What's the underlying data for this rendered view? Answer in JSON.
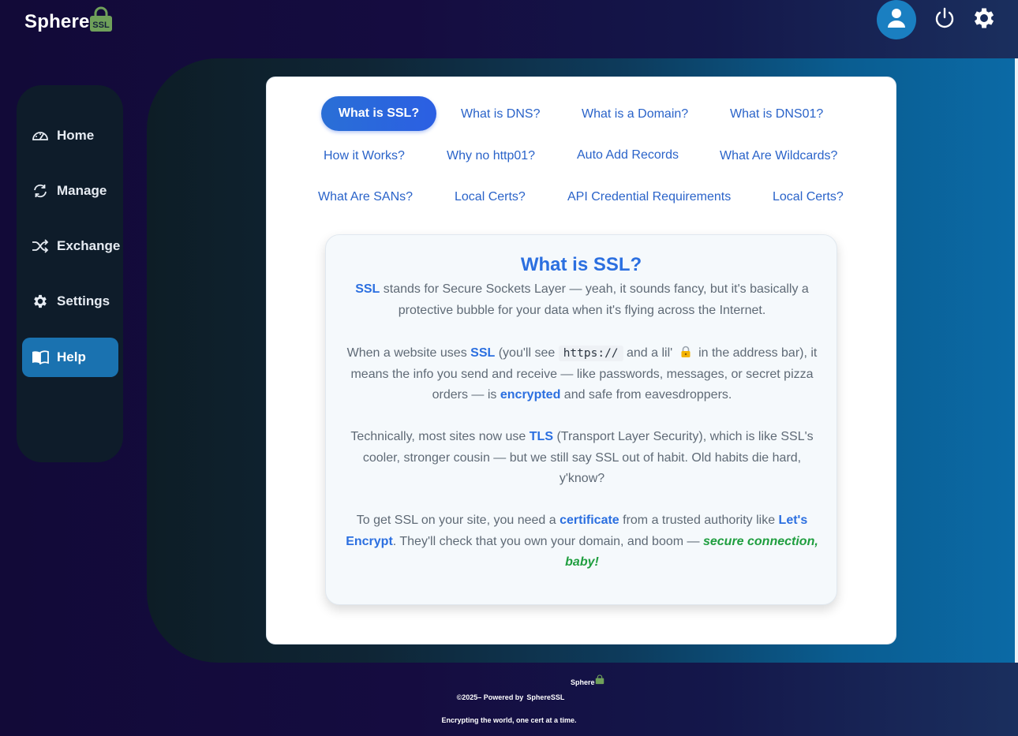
{
  "app": {
    "logo_text": "Sphere",
    "logo_badge": "SSL"
  },
  "header": {
    "icons": [
      "user-icon",
      "power-icon",
      "gear-icon"
    ]
  },
  "sidebar": {
    "items": [
      {
        "label": "Home",
        "icon": "dashboard-icon",
        "active": false
      },
      {
        "label": "Manage",
        "icon": "refresh-icon",
        "active": false
      },
      {
        "label": "Exchange",
        "icon": "shuffle-icon",
        "active": false
      },
      {
        "label": "Settings",
        "icon": "gear-icon",
        "active": false
      },
      {
        "label": "Help",
        "icon": "book-icon",
        "active": true
      }
    ]
  },
  "help": {
    "topics": [
      "What is SSL?",
      "What is DNS?",
      "What is a Domain?",
      "What is DNS01?",
      "How it Works?",
      "Why no http01?",
      "Auto Add Records",
      "What Are Wildcards?",
      "What Are SANs?",
      "Local Certs?",
      "API Credential Requirements",
      "Local Certs?"
    ],
    "active_topic": "What is SSL?",
    "content": {
      "title": "What is SSL?",
      "p1_a": "SSL",
      "p1_b": " stands for Secure Sockets Layer — yeah, it sounds fancy, but it's basically a protective bubble for your data when it's flying across the Internet.",
      "p2_a": "When a website uses ",
      "p2_b": "SSL",
      "p2_c": " (you'll see ",
      "p2_code": "https://",
      "p2_d": " and a lil' ",
      "p2_e": " in the address bar), it means the info you send and receive — like passwords, messages, or secret pizza orders — is ",
      "p2_f": "encrypted",
      "p2_g": " and safe from eavesdroppers.",
      "p3_a": "Technically, most sites now use ",
      "p3_b": "TLS",
      "p3_c": " (Transport Layer Security), which is like SSL's cooler, stronger cousin — but we still say SSL out of habit. Old habits die hard, y'know?",
      "p4_a": "To get SSL on your site, you need a ",
      "p4_b": "certificate",
      "p4_c": " from a trusted authority like ",
      "p4_d": "Let's Encrypt",
      "p4_e": ". They'll check that you own your domain, and boom — ",
      "p4_f": "secure connection, baby!"
    }
  },
  "footer": {
    "logo_text": "Sphere",
    "copyright": "©2025– Powered by",
    "brand": "SphereSSL",
    "tagline": "Encrypting the world, one cert at a time."
  },
  "colors": {
    "accent": "#2b6fe0",
    "active_nav": "#1a72b0",
    "success": "#1f9e3f",
    "logo_green": "#6fa05a"
  }
}
